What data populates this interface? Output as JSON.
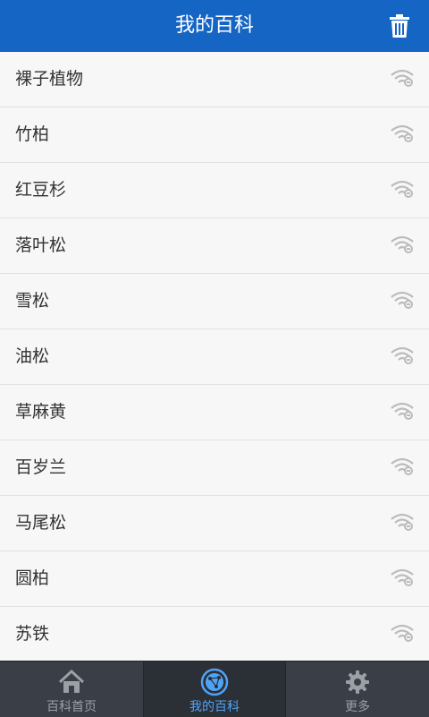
{
  "header": {
    "title": "我的百科"
  },
  "list": {
    "items": [
      {
        "label": "裸子植物"
      },
      {
        "label": "竹柏"
      },
      {
        "label": "红豆杉"
      },
      {
        "label": "落叶松"
      },
      {
        "label": "雪松"
      },
      {
        "label": "油松"
      },
      {
        "label": "草麻黄"
      },
      {
        "label": "百岁兰"
      },
      {
        "label": "马尾松"
      },
      {
        "label": "圆柏"
      },
      {
        "label": "苏铁"
      }
    ]
  },
  "tabbar": {
    "tabs": [
      {
        "label": "百科首页",
        "icon": "home-icon"
      },
      {
        "label": "我的百科",
        "icon": "network-icon"
      },
      {
        "label": "更多",
        "icon": "gear-icon"
      }
    ],
    "active_tab": "我的百科"
  },
  "colors": {
    "header": "#1565c4",
    "tabbar": "#3a3f47",
    "active_tab": "#4fa3f7"
  }
}
